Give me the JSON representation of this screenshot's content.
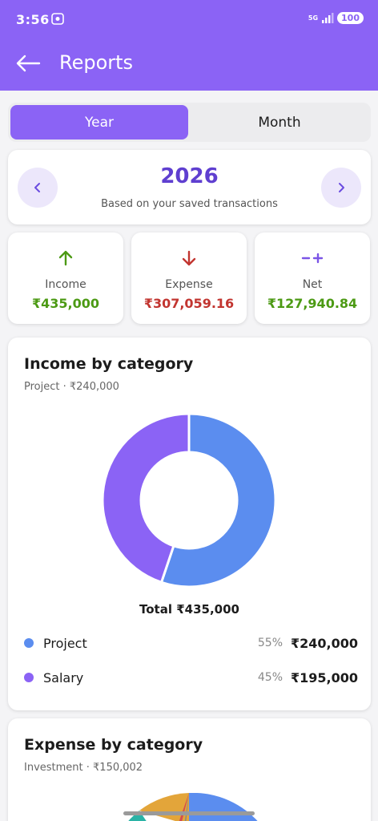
{
  "status_bar": {
    "time": "3:56",
    "network": "5G",
    "battery": "100"
  },
  "header": {
    "title": "Reports"
  },
  "period_toggle": {
    "year_label": "Year",
    "month_label": "Month",
    "selected": "Year"
  },
  "year_selector": {
    "year": "2026",
    "subtitle": "Based on your saved transactions"
  },
  "stats": {
    "income": {
      "label": "Income",
      "value": "₹435,000"
    },
    "expense": {
      "label": "Expense",
      "value": "₹307,059.16"
    },
    "net": {
      "label": "Net",
      "value": "₹127,940.84"
    }
  },
  "income_by_category": {
    "title": "Income by category",
    "subtitle": "Project · ₹240,000",
    "total": "Total ₹435,000",
    "legend": [
      {
        "name": "Project",
        "pct": "55%",
        "amount": "₹240,000",
        "color": "#5b8def"
      },
      {
        "name": "Salary",
        "pct": "45%",
        "amount": "₹195,000",
        "color": "#8b63f5"
      }
    ]
  },
  "expense_by_category": {
    "title": "Expense by category",
    "subtitle": "Investment · ₹150,002"
  },
  "chart_data": {
    "type": "pie",
    "title": "Income by category",
    "categories": [
      "Project",
      "Salary"
    ],
    "values": [
      240000,
      195000
    ],
    "colors": [
      "#5b8def",
      "#8b63f5"
    ],
    "donut": true
  },
  "colors": {
    "accent": "#8b63f5",
    "income": "#4c9a14",
    "expense": "#c23530",
    "year_text": "#5f3fd0"
  }
}
